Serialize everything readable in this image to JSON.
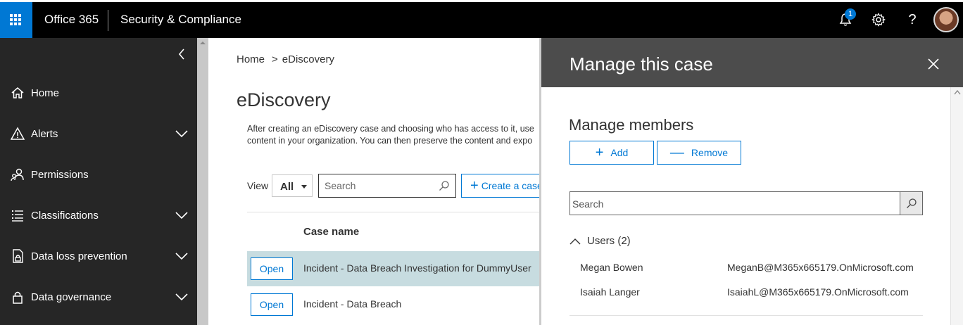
{
  "header": {
    "app_name": "Office 365",
    "suite_name": "Security & Compliance",
    "notification_count": "1",
    "help_label": "?",
    "colors": {
      "bar": "#000000",
      "waffle": "#0078d4"
    }
  },
  "sidebar": {
    "items": [
      {
        "label": "Home",
        "icon": "home-icon",
        "expandable": false
      },
      {
        "label": "Alerts",
        "icon": "alert-icon",
        "expandable": true
      },
      {
        "label": "Permissions",
        "icon": "people-icon",
        "expandable": false
      },
      {
        "label": "Classifications",
        "icon": "list-icon",
        "expandable": true
      },
      {
        "label": "Data loss prevention",
        "icon": "lock-document-icon",
        "expandable": true
      },
      {
        "label": "Data governance",
        "icon": "lock-icon",
        "expandable": true
      }
    ]
  },
  "main": {
    "breadcrumb": {
      "home": "Home",
      "separator": ">",
      "current": "eDiscovery"
    },
    "title": "eDiscovery",
    "description_line1": "After creating an eDiscovery case and choosing who has access to it, use",
    "description_line2": "content in your organization. You can then preserve the content and expo",
    "view_label": "View",
    "view_value": "All",
    "search_placeholder": "Search",
    "create_label": "Create a case",
    "column_header": "Case name",
    "rows": [
      {
        "open_label": "Open",
        "case_name": "Incident - Data Breach Investigation for DummyUser",
        "selected": true
      },
      {
        "open_label": "Open",
        "case_name": "Incident - Data Breach",
        "selected": false
      }
    ]
  },
  "panel": {
    "title": "Manage this case",
    "section_title": "Manage members",
    "add_label": "Add",
    "remove_label": "Remove",
    "search_placeholder": "Search",
    "users_group_label": "Users (2)",
    "members": [
      {
        "name": "Megan Bowen",
        "email": "MeganB@M365x665179.OnMicrosoft.com"
      },
      {
        "name": "Isaiah Langer",
        "email": "IsaiahL@M365x665179.OnMicrosoft.com"
      }
    ]
  }
}
